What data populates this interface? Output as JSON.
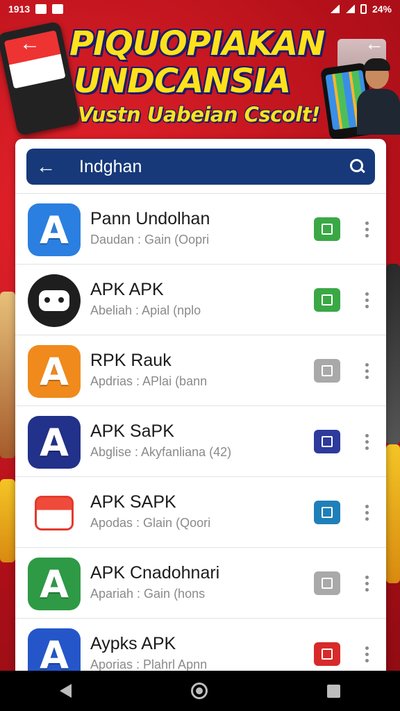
{
  "status_bar": {
    "time": "1913",
    "battery": "24%"
  },
  "banner": {
    "headline_line1": "PIQUOPIAKAN",
    "headline_line2": "UNDCANSIA",
    "subline": "Vustn Uabeian Cscolt!"
  },
  "search": {
    "query": "Indghan"
  },
  "colors": {
    "accent": "#17397a",
    "banner_red": "#c8141c",
    "headline": "#ffe21a"
  },
  "apps": [
    {
      "name": "Pann Undolhan",
      "sub": "Daudan : Gain (Oopri",
      "icon": "letter-a-icon",
      "icon_bg": "#2a7fe0",
      "glyph": "A",
      "action_color": "#3aa845"
    },
    {
      "name": "APK APK",
      "sub": "Abeliah : Apial (nplo",
      "icon": "robot-icon",
      "icon_bg": "#1e1e1e",
      "glyph": "",
      "action_color": "#3aa845"
    },
    {
      "name": "RPK Rauk",
      "sub": "Apdrias : APlai (bann",
      "icon": "letter-a-icon",
      "icon_bg": "#f08a1c",
      "glyph": "A",
      "action_color": "#a9a9a9"
    },
    {
      "name": "APK SaPK",
      "sub": "Abglise : Akyfanliana (42)",
      "icon": "letter-a-icon",
      "icon_bg": "#22318a",
      "glyph": "A",
      "action_color": "#2e3a9c"
    },
    {
      "name": "APK SAPK",
      "sub": "Apodas : Glain (Qoori",
      "icon": "cube-icon",
      "icon_bg": "#ffffff",
      "glyph": "",
      "action_color": "#1f80b8"
    },
    {
      "name": "APK Cnadohnari",
      "sub": "Apariah : Gain (hons",
      "icon": "letter-a-icon",
      "icon_bg": "#2e9a45",
      "glyph": "A",
      "action_color": "#a9a9a9"
    },
    {
      "name": "Aypks APK",
      "sub": "Aporias : Plahrl Apnn",
      "icon": "letter-a-icon",
      "icon_bg": "#2556c9",
      "glyph": "A",
      "action_color": "#d82a2a"
    }
  ]
}
